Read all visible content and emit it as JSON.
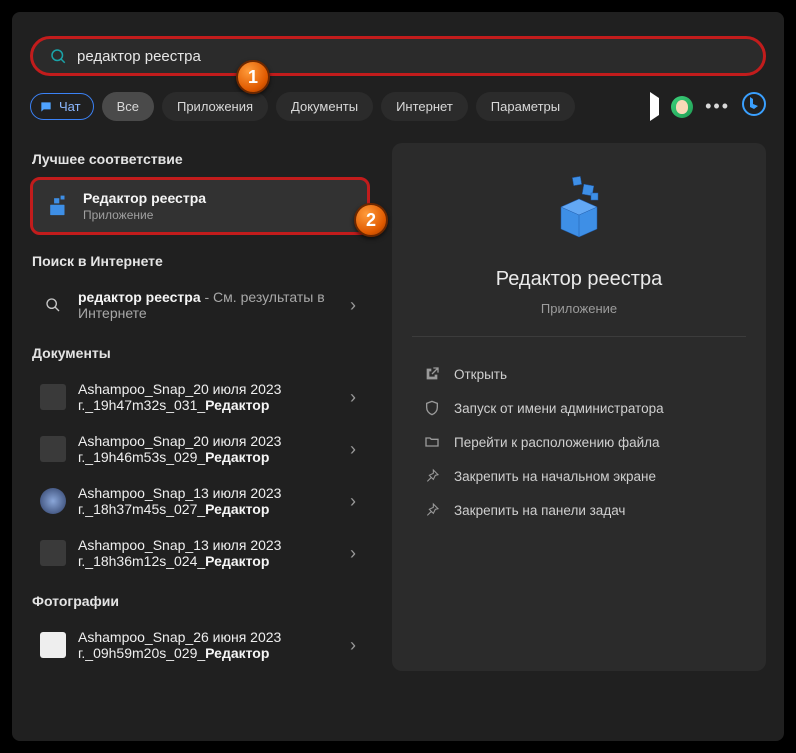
{
  "search": {
    "value": "редактор реестра"
  },
  "filters": {
    "chat": "Чат",
    "all": "Все",
    "apps": "Приложения",
    "docs": "Документы",
    "internet": "Интернет",
    "settings": "Параметры"
  },
  "annotations": {
    "step1": "1",
    "step2": "2"
  },
  "left": {
    "best_match_header": "Лучшее соответствие",
    "best": {
      "title": "Редактор реестра",
      "subtitle": "Приложение"
    },
    "web_header": "Поиск в Интернете",
    "web": {
      "query": "редактор реестра",
      "suffix": " - См. результаты в Интернете"
    },
    "documents_header": "Документы",
    "docs": [
      {
        "l1": "Ashampoo_Snap_20 июля 2023",
        "l2_pre": "г._19h47m32s_031_",
        "l2_bold": "Редактор"
      },
      {
        "l1": "Ashampoo_Snap_20 июля 2023",
        "l2_pre": "г._19h46m53s_029_",
        "l2_bold": "Редактор"
      },
      {
        "l1": "Ashampoo_Snap_13 июля 2023",
        "l2_pre": "г._18h37m45s_027_",
        "l2_bold": "Редактор"
      },
      {
        "l1": "Ashampoo_Snap_13 июля 2023",
        "l2_pre": "г._18h36m12s_024_",
        "l2_bold": "Редактор"
      }
    ],
    "photos_header": "Фотографии",
    "photos": [
      {
        "l1": "Ashampoo_Snap_26 июня 2023",
        "l2_pre": "г._09h59m20s_029_",
        "l2_bold": "Редактор"
      }
    ]
  },
  "right": {
    "title": "Редактор реестра",
    "subtitle": "Приложение",
    "actions": {
      "open": "Открыть",
      "admin": "Запуск от имени администратора",
      "location": "Перейти к расположению файла",
      "pin_start": "Закрепить на начальном экране",
      "pin_taskbar": "Закрепить на панели задач"
    }
  }
}
